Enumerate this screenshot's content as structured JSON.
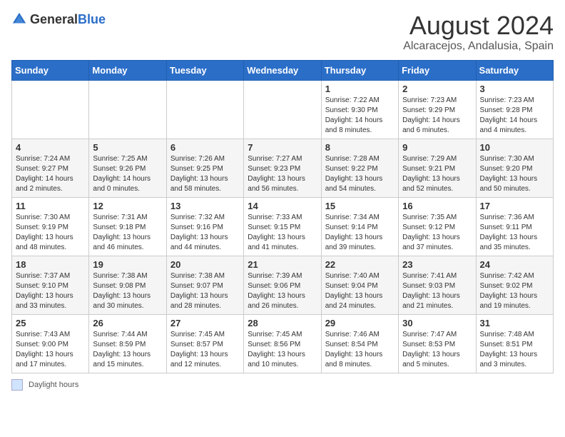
{
  "logo": {
    "general": "General",
    "blue": "Blue"
  },
  "title": "August 2024",
  "subtitle": "Alcaracejos, Andalusia, Spain",
  "weekdays": [
    "Sunday",
    "Monday",
    "Tuesday",
    "Wednesday",
    "Thursday",
    "Friday",
    "Saturday"
  ],
  "weeks": [
    [
      {
        "day": "",
        "info": ""
      },
      {
        "day": "",
        "info": ""
      },
      {
        "day": "",
        "info": ""
      },
      {
        "day": "",
        "info": ""
      },
      {
        "day": "1",
        "info": "Sunrise: 7:22 AM\nSunset: 9:30 PM\nDaylight: 14 hours and 8 minutes."
      },
      {
        "day": "2",
        "info": "Sunrise: 7:23 AM\nSunset: 9:29 PM\nDaylight: 14 hours and 6 minutes."
      },
      {
        "day": "3",
        "info": "Sunrise: 7:23 AM\nSunset: 9:28 PM\nDaylight: 14 hours and 4 minutes."
      }
    ],
    [
      {
        "day": "4",
        "info": "Sunrise: 7:24 AM\nSunset: 9:27 PM\nDaylight: 14 hours and 2 minutes."
      },
      {
        "day": "5",
        "info": "Sunrise: 7:25 AM\nSunset: 9:26 PM\nDaylight: 14 hours and 0 minutes."
      },
      {
        "day": "6",
        "info": "Sunrise: 7:26 AM\nSunset: 9:25 PM\nDaylight: 13 hours and 58 minutes."
      },
      {
        "day": "7",
        "info": "Sunrise: 7:27 AM\nSunset: 9:23 PM\nDaylight: 13 hours and 56 minutes."
      },
      {
        "day": "8",
        "info": "Sunrise: 7:28 AM\nSunset: 9:22 PM\nDaylight: 13 hours and 54 minutes."
      },
      {
        "day": "9",
        "info": "Sunrise: 7:29 AM\nSunset: 9:21 PM\nDaylight: 13 hours and 52 minutes."
      },
      {
        "day": "10",
        "info": "Sunrise: 7:30 AM\nSunset: 9:20 PM\nDaylight: 13 hours and 50 minutes."
      }
    ],
    [
      {
        "day": "11",
        "info": "Sunrise: 7:30 AM\nSunset: 9:19 PM\nDaylight: 13 hours and 48 minutes."
      },
      {
        "day": "12",
        "info": "Sunrise: 7:31 AM\nSunset: 9:18 PM\nDaylight: 13 hours and 46 minutes."
      },
      {
        "day": "13",
        "info": "Sunrise: 7:32 AM\nSunset: 9:16 PM\nDaylight: 13 hours and 44 minutes."
      },
      {
        "day": "14",
        "info": "Sunrise: 7:33 AM\nSunset: 9:15 PM\nDaylight: 13 hours and 41 minutes."
      },
      {
        "day": "15",
        "info": "Sunrise: 7:34 AM\nSunset: 9:14 PM\nDaylight: 13 hours and 39 minutes."
      },
      {
        "day": "16",
        "info": "Sunrise: 7:35 AM\nSunset: 9:12 PM\nDaylight: 13 hours and 37 minutes."
      },
      {
        "day": "17",
        "info": "Sunrise: 7:36 AM\nSunset: 9:11 PM\nDaylight: 13 hours and 35 minutes."
      }
    ],
    [
      {
        "day": "18",
        "info": "Sunrise: 7:37 AM\nSunset: 9:10 PM\nDaylight: 13 hours and 33 minutes."
      },
      {
        "day": "19",
        "info": "Sunrise: 7:38 AM\nSunset: 9:08 PM\nDaylight: 13 hours and 30 minutes."
      },
      {
        "day": "20",
        "info": "Sunrise: 7:38 AM\nSunset: 9:07 PM\nDaylight: 13 hours and 28 minutes."
      },
      {
        "day": "21",
        "info": "Sunrise: 7:39 AM\nSunset: 9:06 PM\nDaylight: 13 hours and 26 minutes."
      },
      {
        "day": "22",
        "info": "Sunrise: 7:40 AM\nSunset: 9:04 PM\nDaylight: 13 hours and 24 minutes."
      },
      {
        "day": "23",
        "info": "Sunrise: 7:41 AM\nSunset: 9:03 PM\nDaylight: 13 hours and 21 minutes."
      },
      {
        "day": "24",
        "info": "Sunrise: 7:42 AM\nSunset: 9:02 PM\nDaylight: 13 hours and 19 minutes."
      }
    ],
    [
      {
        "day": "25",
        "info": "Sunrise: 7:43 AM\nSunset: 9:00 PM\nDaylight: 13 hours and 17 minutes."
      },
      {
        "day": "26",
        "info": "Sunrise: 7:44 AM\nSunset: 8:59 PM\nDaylight: 13 hours and 15 minutes."
      },
      {
        "day": "27",
        "info": "Sunrise: 7:45 AM\nSunset: 8:57 PM\nDaylight: 13 hours and 12 minutes."
      },
      {
        "day": "28",
        "info": "Sunrise: 7:45 AM\nSunset: 8:56 PM\nDaylight: 13 hours and 10 minutes."
      },
      {
        "day": "29",
        "info": "Sunrise: 7:46 AM\nSunset: 8:54 PM\nDaylight: 13 hours and 8 minutes."
      },
      {
        "day": "30",
        "info": "Sunrise: 7:47 AM\nSunset: 8:53 PM\nDaylight: 13 hours and 5 minutes."
      },
      {
        "day": "31",
        "info": "Sunrise: 7:48 AM\nSunset: 8:51 PM\nDaylight: 13 hours and 3 minutes."
      }
    ]
  ],
  "legend": {
    "box_label": "Daylight hours"
  }
}
